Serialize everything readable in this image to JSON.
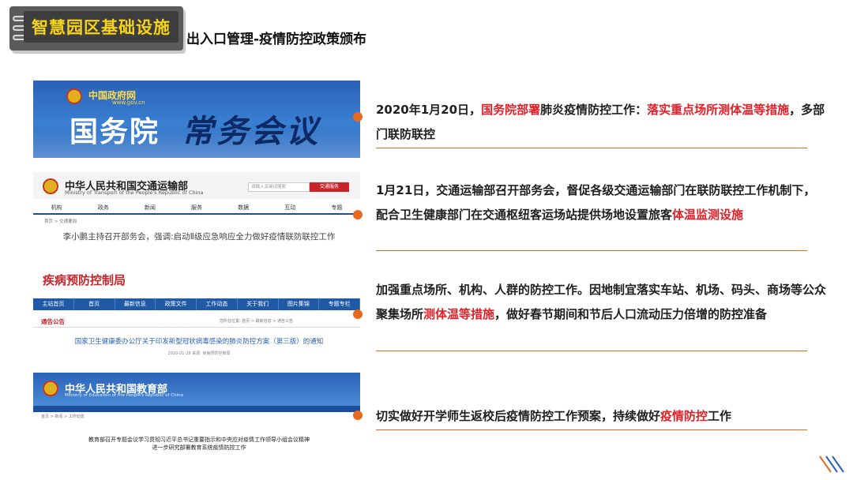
{
  "header": {
    "badge_title": "智慧园区基础设施",
    "subtitle": "出入口管理-疫情防控政策颁布"
  },
  "panels": {
    "p1": {
      "site": "中国政府网",
      "site_sub": "www.gov.cn",
      "big": "国务院",
      "script": "常务会议"
    },
    "p2": {
      "org": "中华人民共和国交通运输部",
      "org_en": "Ministry of Transport of the People's Republic of China",
      "search_placeholder": "请输入关键词搜索",
      "search_button": "交通服务",
      "nav": [
        "机构",
        "政务",
        "新闻",
        "服务",
        "数据",
        "互动",
        "专题"
      ],
      "crumb": "首页 > 交通要闻",
      "headline": "李小鹏主持召开部务会，强调:启动Ⅱ级应急响应全力做好疫情联防联控工作"
    },
    "p3": {
      "org": "疾病预防控制局",
      "nav": [
        "主站首页",
        "首页",
        "最新信息",
        "政策文件",
        "工作动态",
        "关于我们",
        "图片集锦",
        "专题专栏"
      ],
      "section": "通告公告",
      "crumb": "您所在位置: 首页 > 最新信息 > 通告公告",
      "headline": "国家卫生健康委办公厅关于印发新型冠状病毒感染的肺炎防控方案（第三版）的通知",
      "meta": "2020-01-28 来源: 疾病预防控制局"
    },
    "p4": {
      "org": "中华人民共和国教育部",
      "org_en": "Ministry of Education of the People's Republic of China",
      "crumb": "首页 > 新闻 > 工作动态",
      "headline_l1": "教育部召开专题会议学习贯彻习近平总书记重要指示和中央应对疫情工作领导小组会议精神",
      "headline_l2": "进一步研究部署教育系统疫情防控工作"
    }
  },
  "entries": [
    {
      "parts": [
        {
          "text": " 2020年1月20日，",
          "red": false
        },
        {
          "text": "国务院部署",
          "red": true
        },
        {
          "text": "肺炎疫情防控工作：",
          "red": false
        },
        {
          "text": "落实重点场所测体温等措施",
          "red": true
        },
        {
          "text": "，多部门联防联控",
          "red": false
        }
      ]
    },
    {
      "parts": [
        {
          "text": " 1月21日，交通运输部召开部务会，督促各级交通运输部门在联防联控工作机制下，配合卫生健康部门在交通枢纽客运场站提供场地设置旅客",
          "red": false
        },
        {
          "text": "体温监测设施",
          "red": true
        }
      ]
    },
    {
      "parts": [
        {
          "text": "加强重点场所、机构、人群的防控工作。因地制宜落实车站、机场、码头、商场等公众聚集场所",
          "red": false
        },
        {
          "text": "测体温等措施",
          "red": true
        },
        {
          "text": "，做好春节期间和节后人口流动压力倍增的防控准备",
          "red": false
        }
      ]
    },
    {
      "parts": [
        {
          "text": "切实做好开学师生返校后疫情防控工作预案，持续做好",
          "red": false
        },
        {
          "text": "疫情防控",
          "red": true
        },
        {
          "text": "工作",
          "red": false
        }
      ]
    }
  ],
  "colors": {
    "accent_orange": "#e56a1f",
    "highlight_red": "#e21f26",
    "badge_text": "#f5d31a"
  }
}
